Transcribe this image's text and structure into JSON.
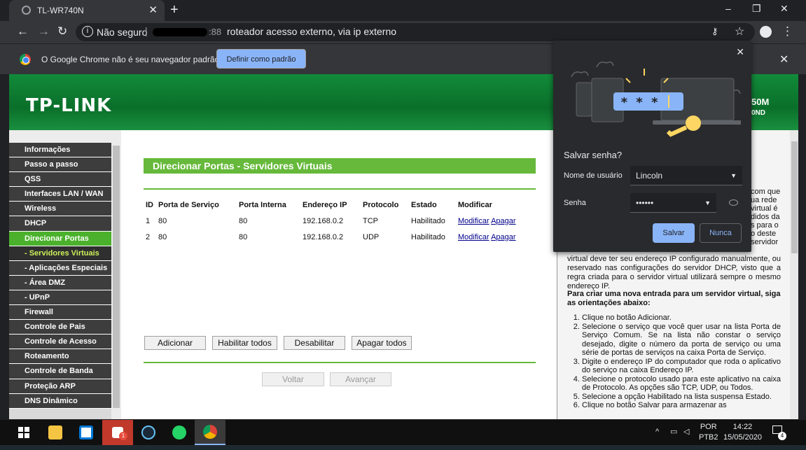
{
  "browser": {
    "tab_title": "TL-WR740N",
    "new_tab": "+",
    "window_minimize": "–",
    "window_restore": "❐",
    "window_close": "✕",
    "security_label": "Não seguro",
    "url_port": ":88",
    "url_text": "roteador acesso externo, via ip externo"
  },
  "infobar": {
    "message": "O Google Chrome não é seu navegador padrão",
    "button": "Definir como padrão"
  },
  "router": {
    "logo": "TP-LINK",
    "model_line1": "50M",
    "model_line2": "0ND",
    "menu": [
      {
        "label": "Informações",
        "kind": "main"
      },
      {
        "label": "Passo a passo",
        "kind": "main"
      },
      {
        "label": "QSS",
        "kind": "main"
      },
      {
        "label": "Interfaces LAN / WAN",
        "kind": "main"
      },
      {
        "label": "Wireless",
        "kind": "main"
      },
      {
        "label": "DHCP",
        "kind": "main"
      },
      {
        "label": "Direcionar Portas",
        "kind": "main-active"
      },
      {
        "label": "- Servidores Virtuais",
        "kind": "sub-active"
      },
      {
        "label": "- Aplicações Especiais",
        "kind": "sub"
      },
      {
        "label": "- Área DMZ",
        "kind": "sub"
      },
      {
        "label": "- UPnP",
        "kind": "sub"
      },
      {
        "label": "Firewall",
        "kind": "main"
      },
      {
        "label": "Controle de Pais",
        "kind": "main"
      },
      {
        "label": "Controle de Acesso",
        "kind": "main"
      },
      {
        "label": "Roteamento",
        "kind": "main"
      },
      {
        "label": "Controle de Banda",
        "kind": "main"
      },
      {
        "label": "Proteção ARP",
        "kind": "main"
      },
      {
        "label": "DNS Dinâmico",
        "kind": "main"
      }
    ],
    "page_title": "Direcionar Portas - Servidores Virtuais",
    "table": {
      "headers": [
        "ID",
        "Porta de Serviço",
        "Porta Interna",
        "Endereço IP",
        "Protocolo",
        "Estado",
        "Modificar"
      ],
      "rows": [
        {
          "id": "1",
          "service_port": "80",
          "internal_port": "80",
          "ip": "192.168.0.2",
          "protocol": "TCP",
          "state": "Habilitado",
          "modify": "Modificar",
          "delete": "Apagar"
        },
        {
          "id": "2",
          "service_port": "80",
          "internal_port": "80",
          "ip": "192.168.0.2",
          "protocol": "UDP",
          "state": "Habilitado",
          "modify": "Modificar",
          "delete": "Apagar"
        }
      ]
    },
    "buttons": {
      "add": "Adicionar",
      "enable_all": "Habilitar todos",
      "disable": "Desabilitar",
      "delete_all": "Apagar todos",
      "back": "Voltar",
      "next": "Avançar"
    },
    "help": {
      "heading": "dores",
      "frag_lines": [
        "com que",
        "ua rede",
        "virtual é",
        "didos da",
        "s para o",
        "o deste",
        "servidor"
      ],
      "paragraph": "virtual deve ter seu endereço IP configurado manualmente, ou reservado nas configurações do servidor DHCP, visto que a regra criada para o servidor virtual utilizará sempre o mesmo endereço IP.",
      "subheading": "Para criar uma nova entrada para um servidor virtual, siga as orientações abaixo:",
      "steps": [
        "Clique no botão Adicionar.",
        "Selecione o serviço que você quer usar na lista Porta de Serviço Comum. Se na lista não constar o serviço desejado, digite o número da porta de serviço ou uma série de portas de serviços na caixa Porta de Serviço.",
        "Digite o endereço IP do computador que roda o aplicativo do serviço na caixa Endereço IP.",
        "Selecione o protocolo usado para este aplicativo na caixa de Protocolo. As opções são TCP, UDP, ou Todos.",
        "Selecione a opção Habilitado na lista suspensa Estado.",
        "Clique no botão Salvar para armazenar as"
      ]
    }
  },
  "password_popup": {
    "title": "Salvar senha?",
    "username_label": "Nome de usuário",
    "username_value": "Lincoln",
    "password_label": "Senha",
    "password_value": "••••••",
    "save_button": "Salvar",
    "never_button": "Nunca",
    "illus_stars": "* * *"
  },
  "taskbar": {
    "lang_line1": "POR",
    "lang_line2": "PTB2",
    "time": "14:22",
    "date": "15/05/2020",
    "notif_count": "4",
    "badge": "1"
  },
  "colors": {
    "router_green": "#66b93a",
    "menu_active": "#4bb12c",
    "sub_active_text": "#cdf05a",
    "chrome_accent": "#8ab4f8"
  }
}
